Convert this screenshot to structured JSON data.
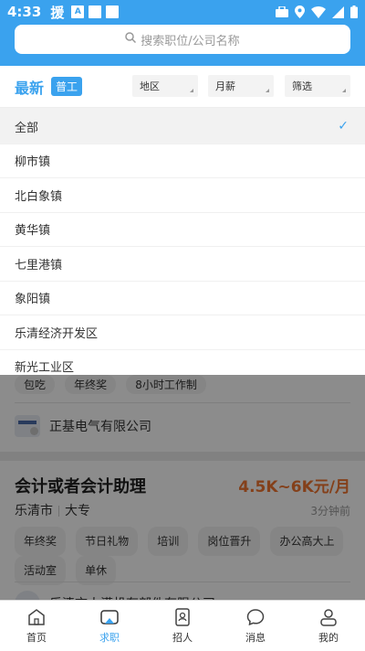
{
  "status_bar": {
    "time": "4:33",
    "app_char": "援",
    "icon_a": "A"
  },
  "search": {
    "placeholder": "搜索职位/公司名称"
  },
  "filter": {
    "tab_latest": "最新",
    "tab_general": "普工",
    "area": "地区",
    "salary": "月薪",
    "filter": "筛选"
  },
  "dropdown": {
    "options": [
      "全部",
      "柳市镇",
      "北白象镇",
      "黄华镇",
      "七里港镇",
      "象阳镇",
      "乐清经济开发区",
      "新光工业区"
    ],
    "selected_index": 0
  },
  "background_list": {
    "job1_tags": [
      "包吃",
      "年终奖",
      "8小时工作制"
    ],
    "job1_company": "正基电气有限公司",
    "job2": {
      "title": "会计或者会计助理",
      "salary": "4.5K~6K元/月",
      "city": "乐清市",
      "education": "大专",
      "posted": "3分钟前",
      "tags": [
        "年终奖",
        "节日礼物",
        "培训",
        "岗位晋升",
        "办公高大上",
        "活动室",
        "单休"
      ],
      "company_partial": "乐清市人满机有部件有限公司"
    }
  },
  "tabbar": {
    "items": [
      "首页",
      "求职",
      "招人",
      "消息",
      "我的"
    ],
    "active_index": 1
  },
  "colors": {
    "brand": "#3aa2ee",
    "salary": "#f07530"
  }
}
